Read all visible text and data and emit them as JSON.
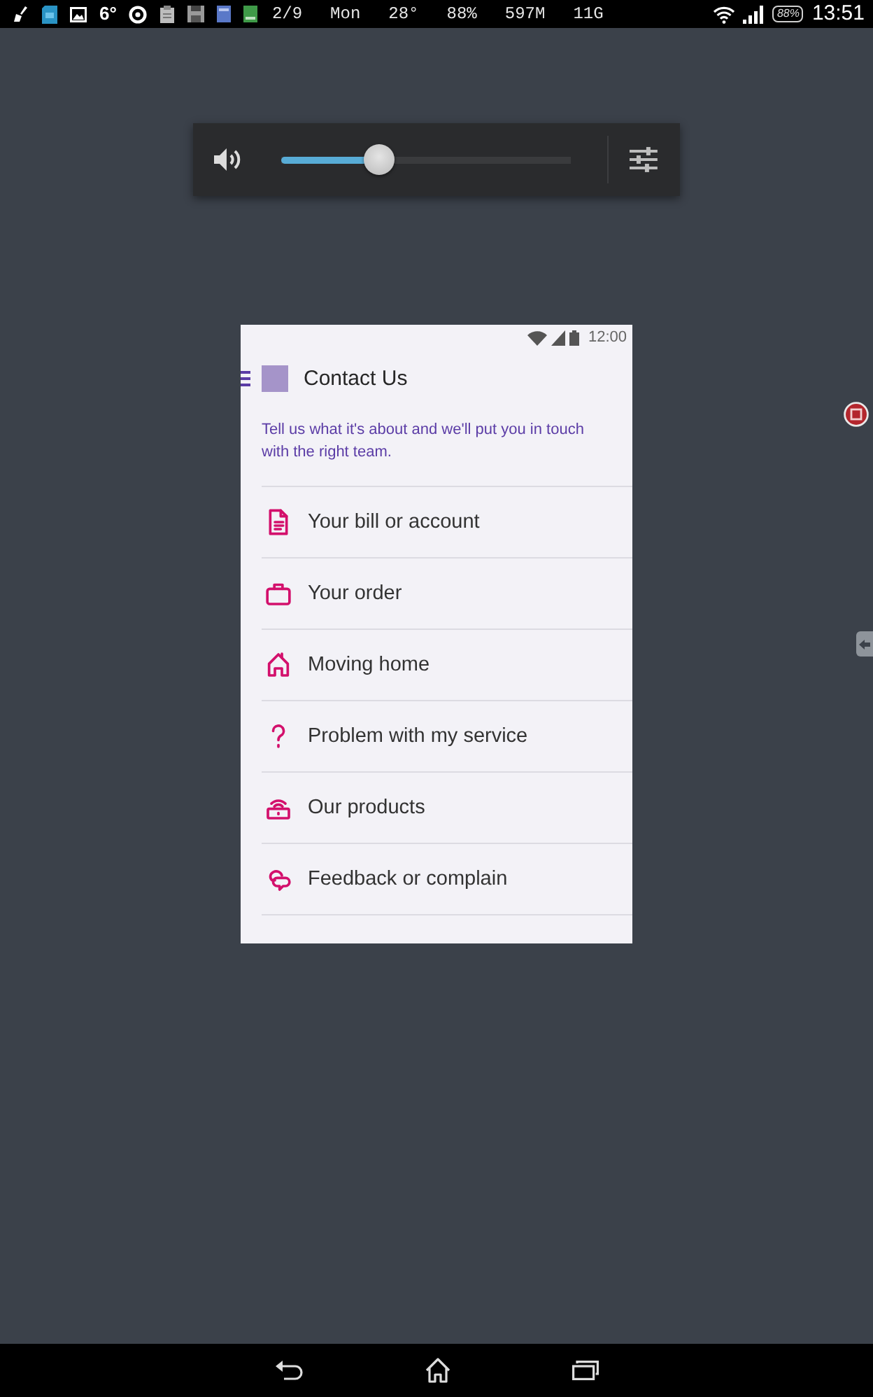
{
  "status_bar": {
    "temperature": "6°",
    "indicators": [
      "2/9",
      "Mon",
      "28°",
      "88%",
      "597M",
      "11G"
    ],
    "battery": "88%",
    "time": "13:51"
  },
  "volume_panel": {
    "level": 0.34
  },
  "app_screen": {
    "status_bar": {
      "time": "12:00"
    },
    "title": "Contact Us",
    "intro": "Tell us what it's about and we'll put you in touch with the right team.",
    "menu_items": [
      {
        "kind": "bill",
        "label": "Your bill or account"
      },
      {
        "kind": "order",
        "label": "Your order"
      },
      {
        "kind": "home",
        "label": "Moving home"
      },
      {
        "kind": "question",
        "label": "Problem with my service"
      },
      {
        "kind": "router",
        "label": "Our products"
      },
      {
        "kind": "feedback",
        "label": "Feedback or complain"
      }
    ]
  }
}
